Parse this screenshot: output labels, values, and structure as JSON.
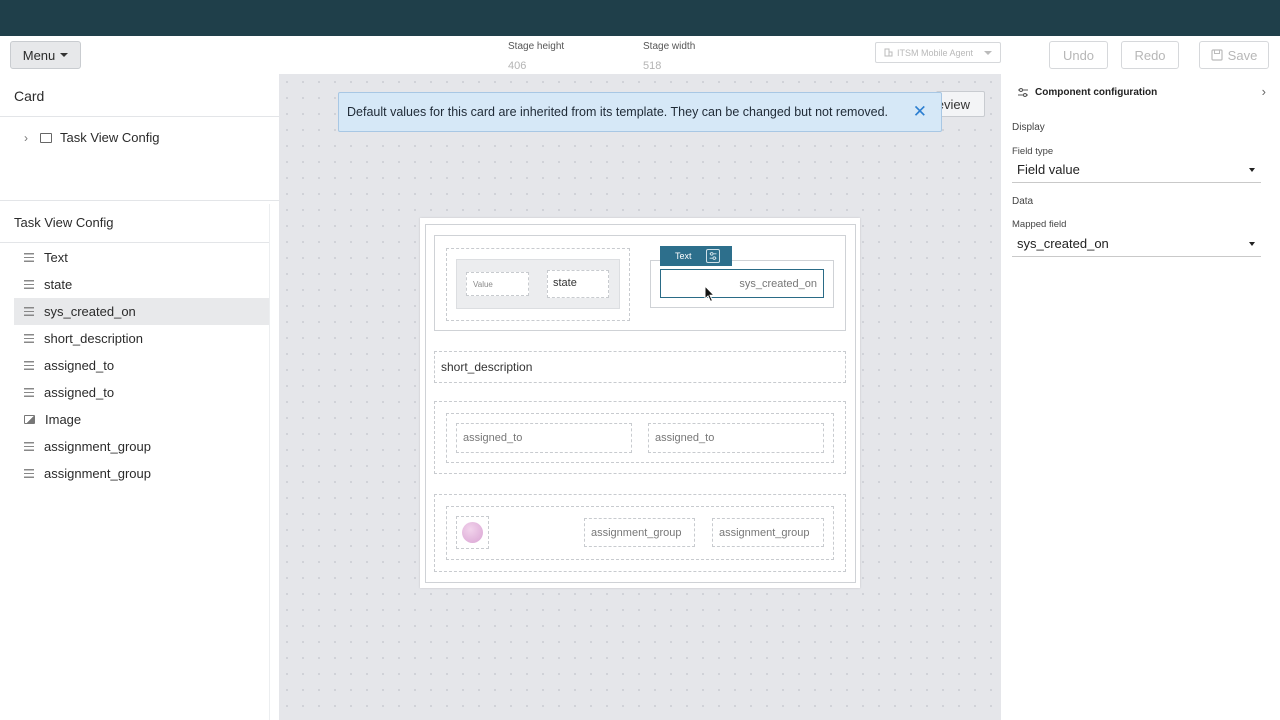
{
  "toolbar": {
    "menu_label": "Menu",
    "stage_height_label": "Stage height",
    "stage_height_value": "406",
    "stage_width_label": "Stage width",
    "stage_width_value": "518",
    "agent_select": "ITSM Mobile Agent",
    "undo_label": "Undo",
    "redo_label": "Redo",
    "save_label": "Save"
  },
  "left_panel": {
    "card_title": "Card",
    "tree_item": "Task View Config",
    "section_title": "Task View Config",
    "items": [
      {
        "label": "Text",
        "icon": "lines-icon"
      },
      {
        "label": "state",
        "icon": "lines-icon"
      },
      {
        "label": "sys_created_on",
        "icon": "lines-icon"
      },
      {
        "label": "short_description",
        "icon": "lines-icon"
      },
      {
        "label": "assigned_to",
        "icon": "lines-icon"
      },
      {
        "label": "assigned_to",
        "icon": "lines-icon"
      },
      {
        "label": "Image",
        "icon": "image-icon"
      },
      {
        "label": "assignment_group",
        "icon": "lines-icon"
      },
      {
        "label": "assignment_group",
        "icon": "lines-icon"
      }
    ]
  },
  "canvas": {
    "preview_label": "eview",
    "banner_text": "Default values for this card are inherited from its template.  They can be changed but not removed.",
    "card": {
      "value_label": "Value",
      "state_field": "state",
      "text_tag": "Text",
      "selected_field": "sys_created_on",
      "short_description": "short_description",
      "assigned_to_1": "assigned_to",
      "assigned_to_2": "assigned_to",
      "assignment_group_1": "assignment_group",
      "assignment_group_2": "assignment_group"
    }
  },
  "right_panel": {
    "title": "Component configuration",
    "display_label": "Display",
    "field_type_label": "Field type",
    "field_type_value": "Field value",
    "data_label": "Data",
    "mapped_field_label": "Mapped field",
    "mapped_field_value": "sys_created_on"
  },
  "colors": {
    "topbar": "#1f3f4a",
    "accent": "#2d6f8c",
    "banner_bg": "#d6e8f7",
    "canvas_bg": "#e5e6ea"
  }
}
